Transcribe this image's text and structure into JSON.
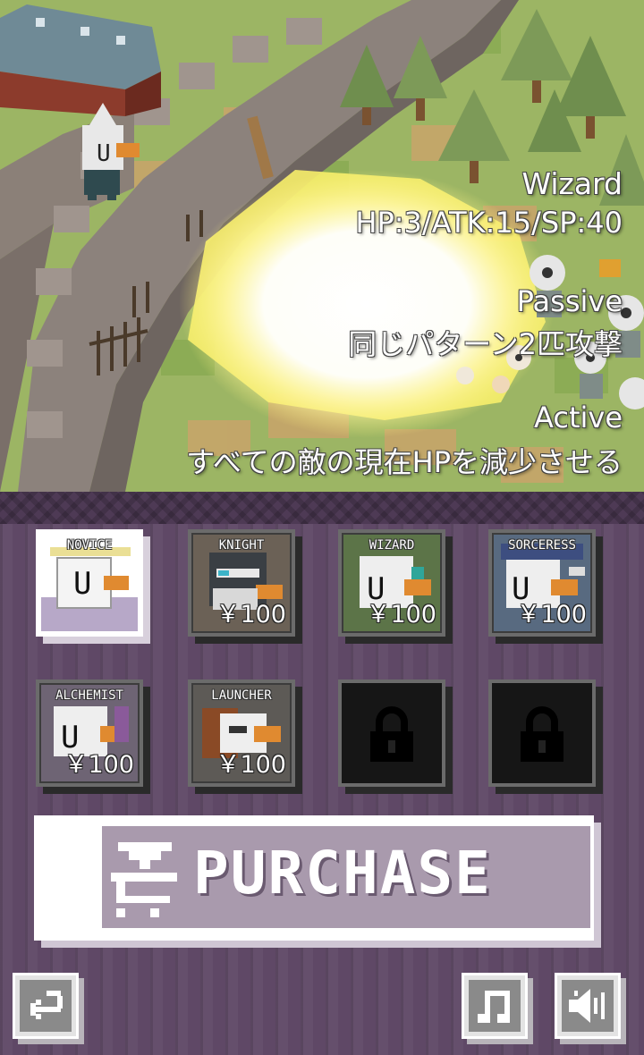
{
  "hero": {
    "name": "Wizard",
    "stats": "HP:3/ATK:15/SP:40",
    "passive_label": "Passive",
    "passive_desc": "同じパターン2匹攻撃",
    "active_label": "Active",
    "active_desc": "すべての敵の現在HPを減少させる"
  },
  "shop": {
    "characters": [
      {
        "name": "NOVICE",
        "price": "",
        "selected": true,
        "locked": false,
        "color": "#b9a7c9"
      },
      {
        "name": "KNIGHT",
        "price": "￥100",
        "selected": false,
        "locked": false,
        "color": "#5a6a74"
      },
      {
        "name": "WIZARD",
        "price": "￥100",
        "selected": false,
        "locked": false,
        "color": "#4d7a5a"
      },
      {
        "name": "SORCERESS",
        "price": "￥100",
        "selected": false,
        "locked": false,
        "color": "#4d6580"
      },
      {
        "name": "ALCHEMIST",
        "price": "￥100",
        "selected": false,
        "locked": false,
        "color": "#6b5a7a"
      },
      {
        "name": "LAUNCHER",
        "price": "￥100",
        "selected": false,
        "locked": false,
        "color": "#7a5a3a"
      },
      {
        "name": "",
        "price": "",
        "selected": false,
        "locked": true,
        "icon": "lock-icon"
      },
      {
        "name": "",
        "price": "",
        "selected": false,
        "locked": true,
        "icon": "lock-icon"
      }
    ],
    "purchase_label": "PURCHASE",
    "purchase_icon": "cart-icon"
  },
  "controls": {
    "back_icon": "back-arrow-icon",
    "music_icon": "music-note-icon",
    "sound_icon": "speaker-icon"
  }
}
